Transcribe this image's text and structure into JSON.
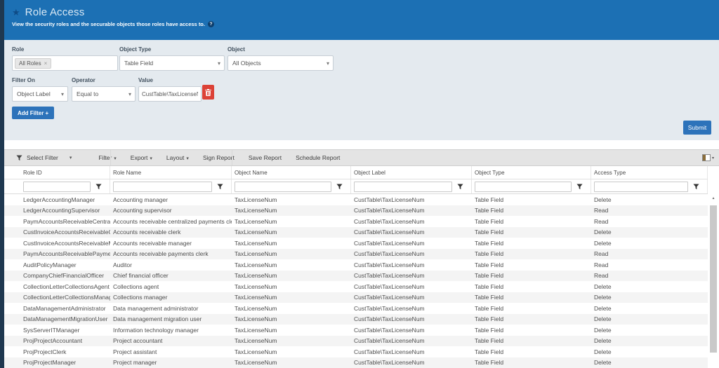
{
  "colors": {
    "header_blue": "#1c70b4",
    "side_strip_navy": "#1f3850",
    "accent_button_blue": "#2d73ba",
    "delete_red": "#dc4237",
    "panel_bg": "#e4eaef"
  },
  "icons": {
    "star": "★",
    "help": "?",
    "caret_down": "▾",
    "tag_remove": "×",
    "scroll_up": "▴",
    "funnel": "filter-funnel-icon",
    "trash": "trash-icon",
    "column_chooser": "column-chooser-icon"
  },
  "header": {
    "title": "Role Access",
    "subtitle": "View the security roles and the securable objects those roles have access to."
  },
  "filters": {
    "role": {
      "label": "Role",
      "tag": "All Roles"
    },
    "object_type": {
      "label": "Object Type",
      "value": "Table Field"
    },
    "object": {
      "label": "Object",
      "value": "All Objects"
    },
    "filter_on": {
      "label": "Filter On",
      "value": "Object Label"
    },
    "operator": {
      "label": "Operator",
      "value": "Equal to"
    },
    "value": {
      "label": "Value",
      "value": "CustTable\\TaxLicenseNum"
    },
    "add_filter_label": "Add Filter +",
    "submit_label": "Submit"
  },
  "toolbar": {
    "select_filter_label": "Select Filter",
    "menus": [
      {
        "label": "Filter",
        "caret": true
      },
      {
        "label": "Export",
        "caret": true
      },
      {
        "label": "Layout",
        "caret": true
      },
      {
        "label": "Sign Report",
        "caret": false
      },
      {
        "label": "Save Report",
        "caret": false
      },
      {
        "label": "Schedule Report",
        "caret": false
      }
    ]
  },
  "table": {
    "columns": [
      "Role ID",
      "Role Name",
      "Object Name",
      "Object Label",
      "Object Type",
      "Access Type"
    ],
    "rows": [
      [
        "LedgerAccountingManager",
        "Accounting manager",
        "TaxLicenseNum",
        "CustTable\\TaxLicenseNum",
        "Table Field",
        "Delete"
      ],
      [
        "LedgerAccountingSupervisor",
        "Accounting supervisor",
        "TaxLicenseNum",
        "CustTable\\TaxLicenseNum",
        "Table Field",
        "Read"
      ],
      [
        "PaymAccountsReceivableCentralPaymClerk",
        "Accounts receivable centralized payments clerk",
        "TaxLicenseNum",
        "CustTable\\TaxLicenseNum",
        "Table Field",
        "Read"
      ],
      [
        "CustInvoiceAccountsReceivableClerk",
        "Accounts receivable clerk",
        "TaxLicenseNum",
        "CustTable\\TaxLicenseNum",
        "Table Field",
        "Delete"
      ],
      [
        "CustInvoiceAccountsReceivableManager",
        "Accounts receivable manager",
        "TaxLicenseNum",
        "CustTable\\TaxLicenseNum",
        "Table Field",
        "Delete"
      ],
      [
        "PaymAccountsReceivablePaymentsClerk",
        "Accounts receivable payments clerk",
        "TaxLicenseNum",
        "CustTable\\TaxLicenseNum",
        "Table Field",
        "Read"
      ],
      [
        "AuditPolicyManager",
        "Auditor",
        "TaxLicenseNum",
        "CustTable\\TaxLicenseNum",
        "Table Field",
        "Read"
      ],
      [
        "CompanyChiefFinancialOfficer",
        "Chief financial officer",
        "TaxLicenseNum",
        "CustTable\\TaxLicenseNum",
        "Table Field",
        "Read"
      ],
      [
        "CollectionLetterCollectionsAgent",
        "Collections agent",
        "TaxLicenseNum",
        "CustTable\\TaxLicenseNum",
        "Table Field",
        "Delete"
      ],
      [
        "CollectionLetterCollectionsManager",
        "Collections manager",
        "TaxLicenseNum",
        "CustTable\\TaxLicenseNum",
        "Table Field",
        "Delete"
      ],
      [
        "DataManagementAdministrator",
        "Data management administrator",
        "TaxLicenseNum",
        "CustTable\\TaxLicenseNum",
        "Table Field",
        "Delete"
      ],
      [
        "DataManagementMigrationUser",
        "Data management migration user",
        "TaxLicenseNum",
        "CustTable\\TaxLicenseNum",
        "Table Field",
        "Delete"
      ],
      [
        "SysServerITManager",
        "Information technology manager",
        "TaxLicenseNum",
        "CustTable\\TaxLicenseNum",
        "Table Field",
        "Delete"
      ],
      [
        "ProjProjectAccountant",
        "Project accountant",
        "TaxLicenseNum",
        "CustTable\\TaxLicenseNum",
        "Table Field",
        "Delete"
      ],
      [
        "ProjProjectClerk",
        "Project assistant",
        "TaxLicenseNum",
        "CustTable\\TaxLicenseNum",
        "Table Field",
        "Delete"
      ],
      [
        "ProjProjectManager",
        "Project manager",
        "TaxLicenseNum",
        "CustTable\\TaxLicenseNum",
        "Table Field",
        "Delete"
      ]
    ]
  }
}
